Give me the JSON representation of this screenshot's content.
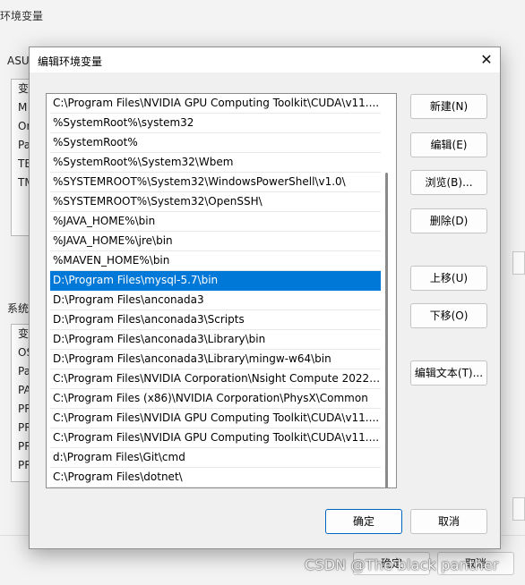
{
  "background": {
    "window_title": "环境变量",
    "user_section_label": "ASU",
    "user_list": [
      "变",
      "M",
      "Or",
      "Pa",
      "TE",
      "TM"
    ],
    "system_section_label": "系统",
    "system_list": [
      "变",
      "OS",
      "Pa",
      "PA",
      "PR",
      "PR",
      "PR",
      "PR"
    ],
    "ok_label": "确定",
    "cancel_label": "取消"
  },
  "dialog": {
    "title": "编辑环境变量",
    "close_glyph": "✕",
    "entries": [
      "C:\\Program Files\\NVIDIA GPU Computing Toolkit\\CUDA\\v11....",
      "%SystemRoot%\\system32",
      "%SystemRoot%",
      "%SystemRoot%\\System32\\Wbem",
      "%SYSTEMROOT%\\System32\\WindowsPowerShell\\v1.0\\",
      "%SYSTEMROOT%\\System32\\OpenSSH\\",
      "%JAVA_HOME%\\bin",
      "%JAVA_HOME%\\jre\\bin",
      "%MAVEN_HOME%\\bin",
      "D:\\Program Files\\mysql-5.7\\bin",
      "D:\\Program Files\\anconada3",
      "D:\\Program Files\\anconada3\\Scripts",
      "D:\\Program Files\\anconada3\\Library\\bin",
      "D:\\Program Files\\anconada3\\Library\\mingw-w64\\bin",
      "C:\\Program Files\\NVIDIA Corporation\\Nsight Compute 2022....",
      "C:\\Program Files (x86)\\NVIDIA Corporation\\PhysX\\Common",
      "C:\\Program Files\\NVIDIA GPU Computing Toolkit\\CUDA\\v11....",
      "C:\\Program Files\\NVIDIA GPU Computing Toolkit\\CUDA\\v11....",
      "d:\\Program Files\\Git\\cmd",
      "C:\\Program Files\\dotnet\\"
    ],
    "selected_index": 9,
    "buttons": {
      "new": "新建(N)",
      "edit": "编辑(E)",
      "browse": "浏览(B)...",
      "delete": "删除(D)",
      "move_up": "上移(U)",
      "move_down": "下移(O)",
      "edit_text": "编辑文本(T)...",
      "ok": "确定",
      "cancel": "取消"
    }
  },
  "watermark": "CSDN @The black panther",
  "colors": {
    "selection": "#0078d7",
    "primary_border": "#0067c0"
  }
}
